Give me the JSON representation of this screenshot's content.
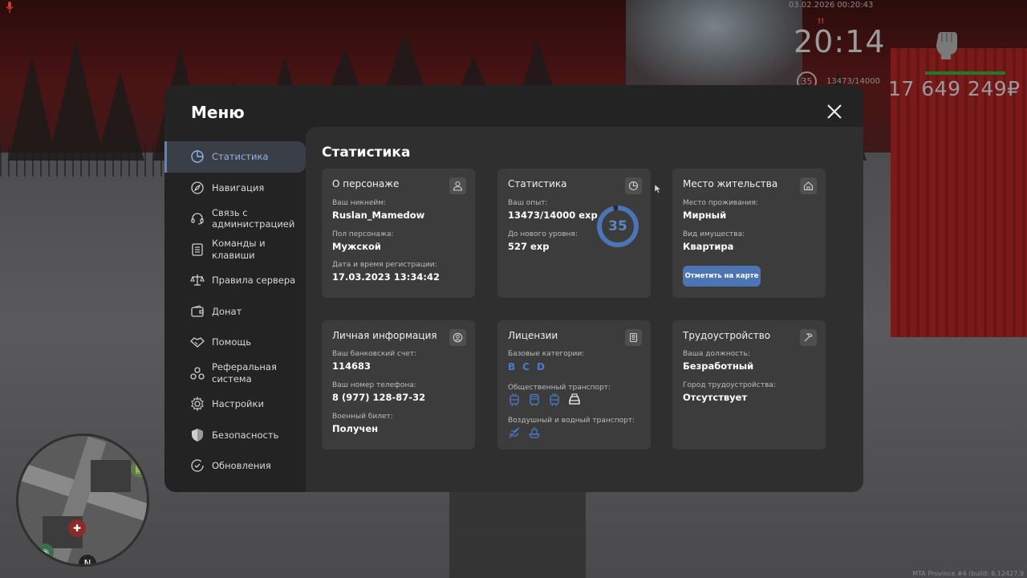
{
  "hud": {
    "datetime": "03.02.2026 00:20:43",
    "clock": "20:14",
    "level": "35",
    "exp": "13473/14000",
    "money": "17 649 249₽",
    "build": "MTA Province #4 (build: 6.12427.9"
  },
  "menu": {
    "title": "Меню",
    "sidebar": [
      {
        "label": "Статистика",
        "icon": "pie-chart-icon",
        "active": true
      },
      {
        "label": "Навигация",
        "icon": "compass-icon"
      },
      {
        "label": "Связь с администрацией",
        "icon": "headset-icon"
      },
      {
        "label": "Команды и клавиши",
        "icon": "document-icon"
      },
      {
        "label": "Правила сервера",
        "icon": "scales-icon"
      },
      {
        "label": "Донат",
        "icon": "wallet-icon"
      },
      {
        "label": "Помощь",
        "icon": "handshake-icon"
      },
      {
        "label": "Реферальная система",
        "icon": "referral-icon"
      },
      {
        "label": "Настройки",
        "icon": "gear-icon"
      },
      {
        "label": "Безопасность",
        "icon": "shield-icon"
      },
      {
        "label": "Обновления",
        "icon": "update-icon"
      }
    ],
    "content_title": "Статистика"
  },
  "cards": {
    "character": {
      "title": "О персонаже",
      "nickname_label": "Ваш никнейм:",
      "nickname": "Ruslan_Mamedow",
      "gender_label": "Пол персонажа:",
      "gender": "Мужской",
      "reg_label": "Дата и время регистрации:",
      "reg": "17.03.2023 13:34:42"
    },
    "stats": {
      "title": "Статистика",
      "exp_label": "Ваш опыт:",
      "exp": "13473/14000 exp",
      "next_label": "До нового уровня:",
      "next": "527 exp",
      "level": "35",
      "progress": 0.962
    },
    "residence": {
      "title": "Место жительства",
      "place_label": "Место проживания:",
      "place": "Мирный",
      "property_label": "Вид имущества:",
      "property": "Квартира",
      "map_button": "Отметить на карте"
    },
    "personal": {
      "title": "Личная информация",
      "bank_label": "Ваш банковский счет:",
      "bank": "114683",
      "phone_label": "Ваш номер телефона:",
      "phone": "8 (977) 128-87-32",
      "military_label": "Военный билет:",
      "military": "Получен"
    },
    "licenses": {
      "title": "Лицензии",
      "basic_label": "Базовые категории:",
      "basic": [
        "B",
        "C",
        "D"
      ],
      "public_label": "Общественный транспорт:",
      "air_label": "Воздушный и водный транспорт:"
    },
    "employment": {
      "title": "Трудоустройство",
      "position_label": "Ваша должность:",
      "position": "Безработный",
      "city_label": "Город трудоустройства:",
      "city": "Отсутствует"
    }
  },
  "colors": {
    "accent": "#4d74b4",
    "panel": "#232323",
    "content": "#2f2f2f",
    "card": "#3c3c3c"
  }
}
